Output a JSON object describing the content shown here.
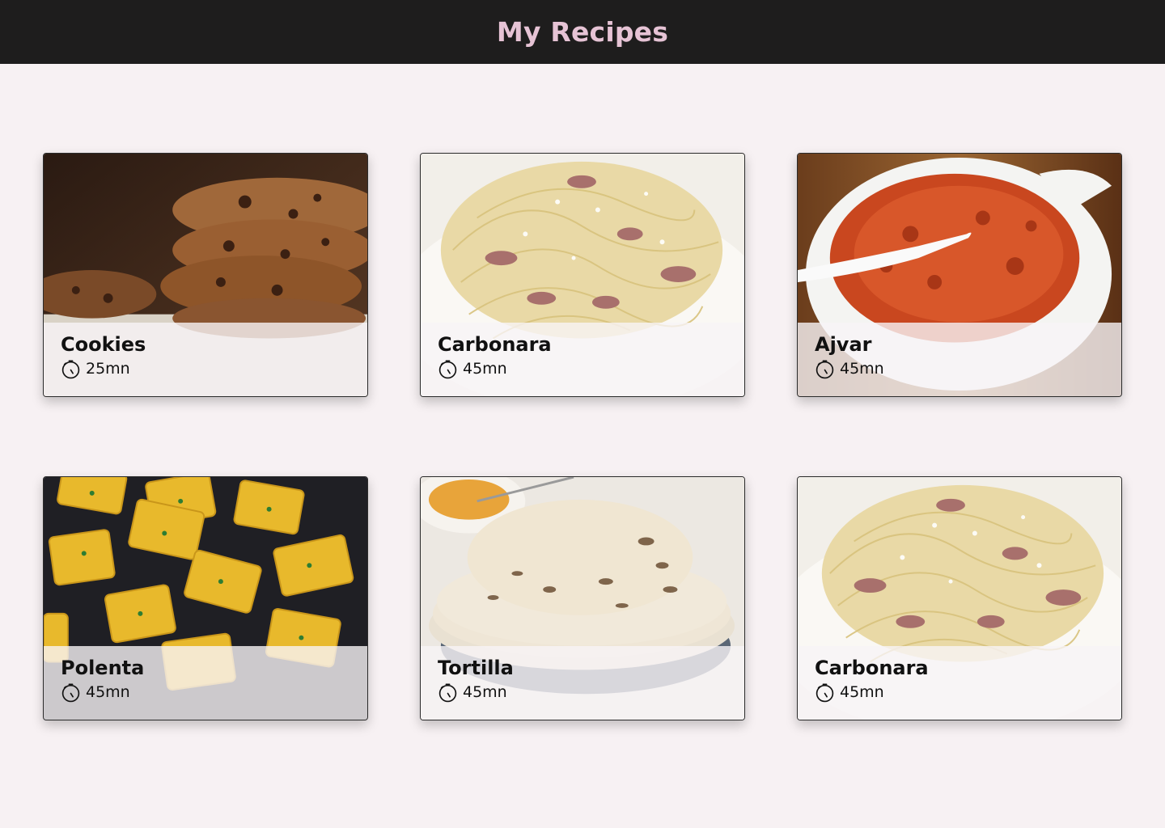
{
  "header": {
    "title": "My Recipes"
  },
  "recipes": [
    {
      "title": "Cookies",
      "time": "25mn",
      "photo": "cookies-photo"
    },
    {
      "title": "Carbonara",
      "time": "45mn",
      "photo": "carbonara-photo"
    },
    {
      "title": "Ajvar",
      "time": "45mn",
      "photo": "ajvar-photo"
    },
    {
      "title": "Polenta",
      "time": "45mn",
      "photo": "polenta-photo"
    },
    {
      "title": "Tortilla",
      "time": "45mn",
      "photo": "tortilla-photo"
    },
    {
      "title": "Carbonara",
      "time": "45mn",
      "photo": "carbonara-photo"
    }
  ],
  "icons": {
    "time": "timer-icon"
  },
  "colors": {
    "header_bg": "#1e1d1d",
    "header_text": "#e6c3d5",
    "page_bg": "#f7f1f3"
  }
}
